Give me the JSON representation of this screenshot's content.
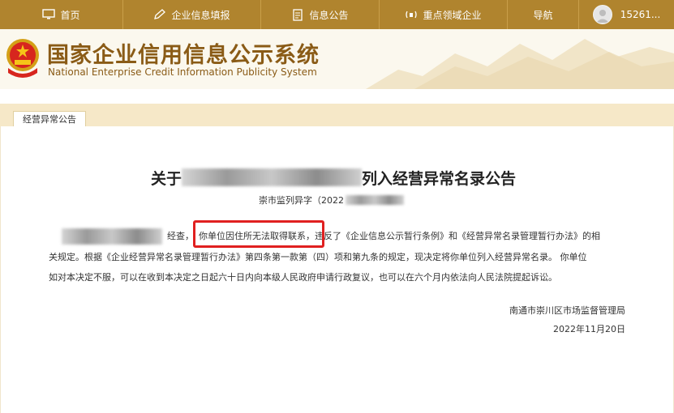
{
  "colors": {
    "nav_bg": "#b0842e",
    "title_brown": "#8a5b16",
    "tab_strip": "#f6e8c8",
    "highlight_red": "#e02020"
  },
  "nav": {
    "items": [
      {
        "label": "首页",
        "icon": "monitor-icon"
      },
      {
        "label": "企业信息填报",
        "icon": "edit-icon"
      },
      {
        "label": "信息公告",
        "icon": "document-icon"
      },
      {
        "label": "重点领域企业",
        "icon": "broadcast-icon"
      },
      {
        "label": "导航",
        "icon": ""
      }
    ],
    "user": {
      "label": "15261...",
      "icon": "user-avatar-icon"
    }
  },
  "header": {
    "title": "国家企业信用信息公示系统",
    "subtitle": "National Enterprise Credit Information Publicity System"
  },
  "tab": {
    "label": "经营异常公告"
  },
  "notice": {
    "title_prefix": "关于",
    "title_suffix": "列入经营异常名录公告",
    "ref_prefix": "崇市监列异字（2022",
    "line1_a": "经查，",
    "line1_b": "你单位因住所无法取得联系，",
    "line1_c": "违反了《企业信息公示暂行条例》和《经营异常名录管理暂行办法》的相",
    "line2": "关规定。根据《企业经营异常名录管理暂行办法》第四条第一款第（四）项和第九条的规定，现决定将你单位列入经营异常名录。 你单位",
    "line3": "如对本决定不服，可以在收到本决定之日起六十日内向本级人民政府申请行政复议，也可以在六个月内依法向人民法院提起诉讼。",
    "signer": "南通市崇川区市场监督管理局",
    "date": "2022年11月20日"
  }
}
